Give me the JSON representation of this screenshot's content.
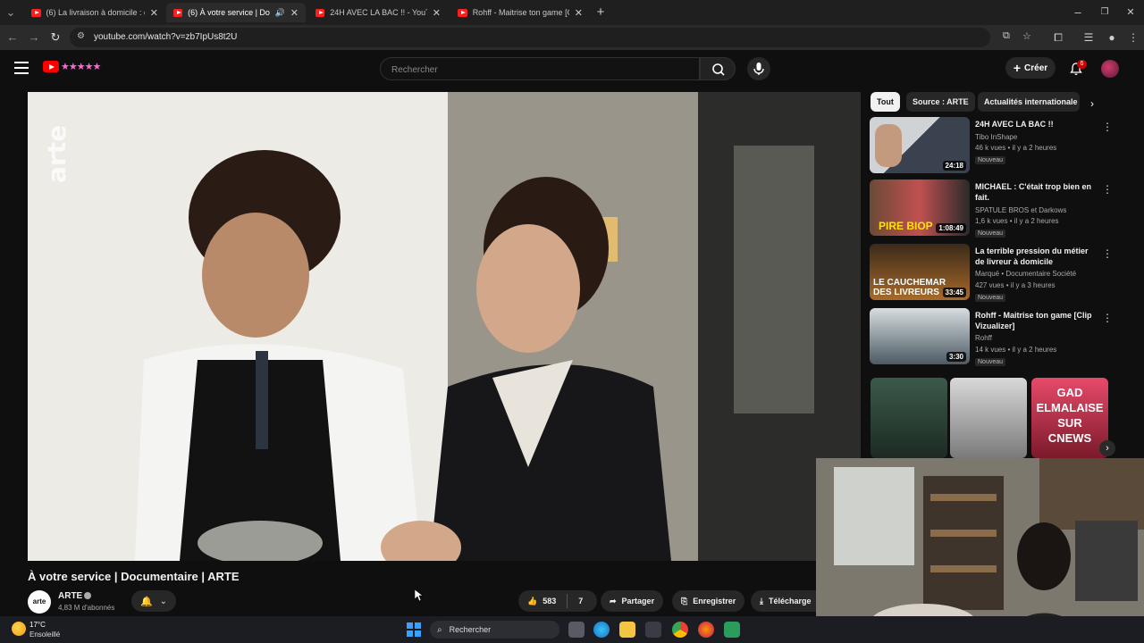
{
  "browser": {
    "tabs": [
      {
        "label": "(6) La livraison à domicile : de l'",
        "active": false
      },
      {
        "label": "(6) À votre service | Docum",
        "active": true
      },
      {
        "label": "24H AVEC LA BAC !! - YouTube",
        "active": false
      },
      {
        "label": "Rohff - Maitrise ton game [Clip",
        "active": false
      }
    ],
    "url": "youtube.com/watch?v=zb7IpUs8t2U"
  },
  "youtube": {
    "search_placeholder": "Rechercher",
    "create_label": "Créer",
    "notification_count": "6"
  },
  "player": {
    "watermark": "arte"
  },
  "video": {
    "title": "À votre service | Documentaire | ARTE",
    "channel": "ARTE",
    "channel_avatar": "arte",
    "subscribers": "4,83 M d'abonnés",
    "likes": "583",
    "comments": "7",
    "share_label": "Partager",
    "save_label": "Enregistrer",
    "download_label": "Télécharge"
  },
  "sidebar": {
    "chips": [
      "Tout",
      "Source : ARTE",
      "Actualités internationale"
    ],
    "recommendations": [
      {
        "title": "24H AVEC LA BAC !!",
        "channel": "Tibo InShape",
        "meta": "46 k vues • il y a 2 heures",
        "badge": "Nouveau",
        "duration": "24:18",
        "thumb_text": ""
      },
      {
        "title": "MICHAEL : C'était trop bien en fait.",
        "channel": "SPATULE BROS et Darkows",
        "meta": "1,6 k vues • il y a 2 heures",
        "badge": "Nouveau",
        "duration": "1:08:49",
        "thumb_text": "PIRE BIOP"
      },
      {
        "title": "La terrible pression du métier de livreur à domicile",
        "channel": "Marqué • Documentaire Société",
        "meta": "427 vues • il y a 3 heures",
        "badge": "Nouveau",
        "duration": "33:45",
        "thumb_text": "LE CAUCHEMAR DES LIVREURS"
      },
      {
        "title": "Rohff - Maitrise ton game [Clip Vizualizer]",
        "channel": "Rohff",
        "meta": "14 k vues • il y a 2 heures",
        "badge": "Nouveau",
        "duration": "3:30",
        "thumb_text": ""
      }
    ],
    "shorts": [
      {
        "text": ""
      },
      {
        "text": ""
      },
      {
        "text": "GAD ELMALAISE SUR CNEWS"
      }
    ]
  },
  "taskbar": {
    "temperature": "17°C",
    "condition": "Ensoleillé",
    "search_label": "Rechercher"
  },
  "colors": {
    "background": "#0f0f0f",
    "youtube_red": "#ff0000",
    "chip_active": "#f1f1f1",
    "pill": "#272727"
  }
}
